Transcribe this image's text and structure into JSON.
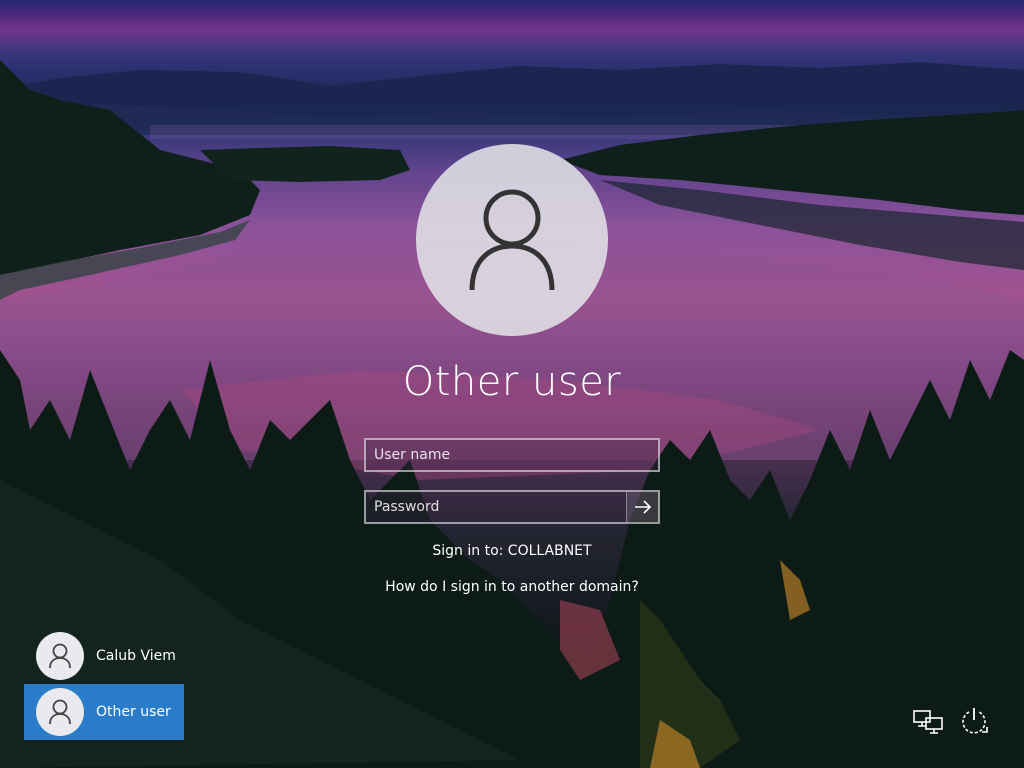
{
  "login": {
    "username_title": "Other user",
    "username_placeholder": "User name",
    "password_placeholder": "Password",
    "sign_in_to": "Sign in to: COLLABNET",
    "domain_help_link": "How do I sign in to another domain?"
  },
  "user_list": [
    {
      "name": "Calub Viem",
      "selected": false
    },
    {
      "name": "Other user",
      "selected": true
    }
  ],
  "icons": {
    "avatar": "person-icon",
    "submit": "arrow-right-icon",
    "network": "network-icon",
    "power": "power-icon"
  },
  "colors": {
    "selected_user": "#2a7cc8",
    "text": "#ffffff"
  }
}
